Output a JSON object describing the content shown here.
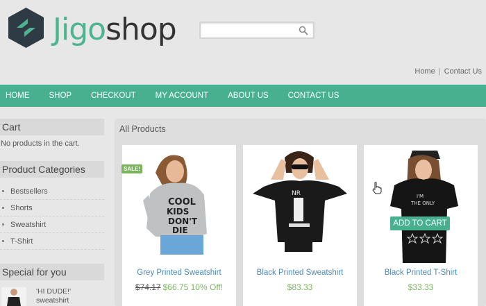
{
  "brand": {
    "part1": "Jigo",
    "part2": "shop"
  },
  "search": {
    "placeholder": ""
  },
  "top_links": [
    "Home",
    "Contact Us"
  ],
  "nav": [
    "HOME",
    "SHOP",
    "CHECKOUT",
    "MY ACCOUNT",
    "ABOUT US",
    "CONTACT US"
  ],
  "sidebar": {
    "cart_title": "Cart",
    "cart_text": "No products in the cart.",
    "categories_title": "Product Categories",
    "categories": [
      "Bestsellers",
      "Shorts",
      "Sweatshirt",
      "T-Shirt"
    ],
    "special_title": "Special for you",
    "special_item": "'HI DUDE!'",
    "special_item_sub": "sweatshirt"
  },
  "main": {
    "title": "All Products",
    "sale_badge": "SALE!",
    "add_to_cart": "ADD TO CART",
    "products": [
      {
        "name": "Grey Printed Sweatshirt",
        "old_price": "$74.17",
        "price": "$66.75 10% Off!"
      },
      {
        "name": "Black Printed Sweatshirt",
        "old_price": "",
        "price": "$83.33"
      },
      {
        "name": "Black Printed T-Shirt",
        "old_price": "",
        "price": "$33.33"
      }
    ]
  },
  "colors": {
    "accent": "#48b08f",
    "link": "#4a89b8",
    "price": "#7bb661"
  },
  "icons": [
    "jigoshop-logo",
    "search-icon",
    "hand-cursor-icon"
  ]
}
